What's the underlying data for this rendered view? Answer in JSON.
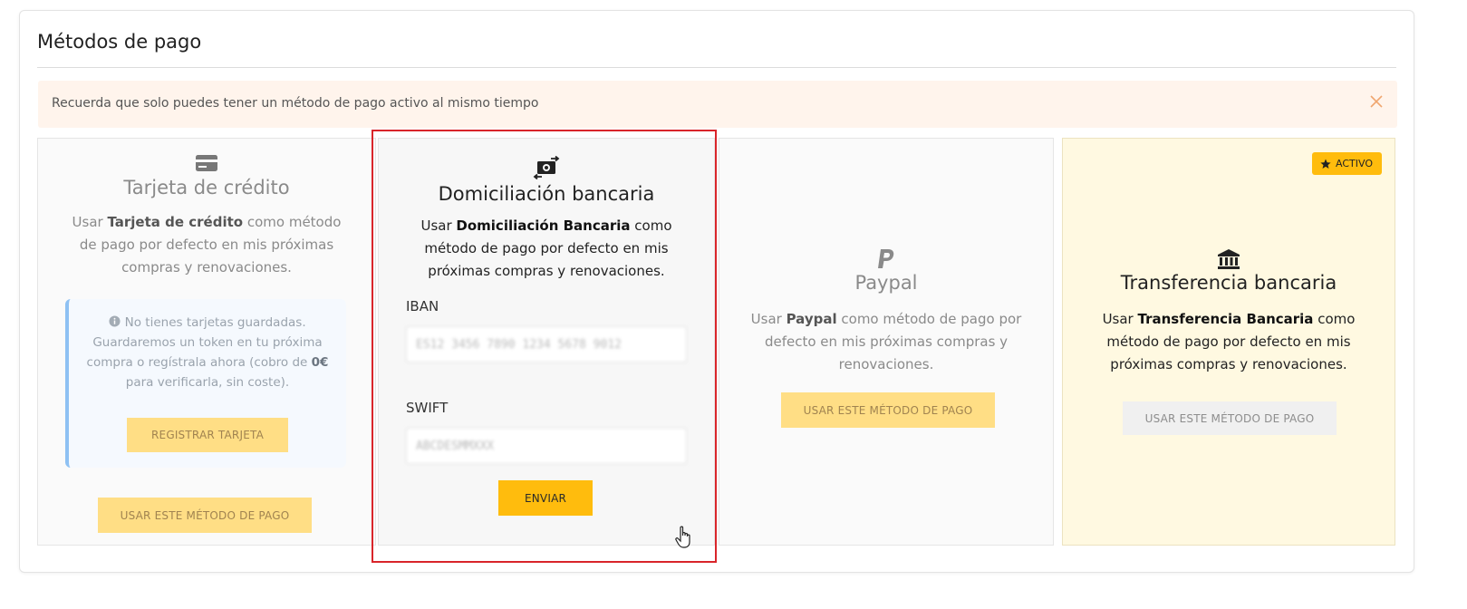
{
  "panel": {
    "title": "Métodos de pago"
  },
  "alert": {
    "text": "Recuerda que solo puedes tener un método de pago activo al mismo tiempo",
    "close_icon": "close-icon"
  },
  "cards": {
    "credit_card": {
      "icon": "credit-card-icon",
      "title": "Tarjeta de crédito",
      "desc_prefix": "Usar ",
      "desc_bold": "Tarjeta de crédito",
      "desc_suffix": " como método de pago por defecto en mis próximas compras y renovaciones.",
      "info_icon": "info-icon",
      "info_text_1": " No tienes tarjetas guardadas. Guardaremos un token en tu próxima compra o regístrala ahora (cobro de ",
      "info_bold": "0€",
      "info_text_2": " para verificarla, sin coste).",
      "register_button": "REGISTRAR TARJETA",
      "use_button": "USAR ESTE MÉTODO DE PAGO"
    },
    "direct_debit": {
      "icon": "money-transfer-icon",
      "title": "Domiciliación bancaria",
      "desc_prefix": "Usar ",
      "desc_bold": "Domiciliación Bancaria",
      "desc_suffix": " como método de pago por defecto en mis próximas compras y renovaciones.",
      "iban_label": "IBAN",
      "iban_value": "ES12 3456 7890 1234 5678 9012",
      "swift_label": "SWIFT",
      "swift_value": "ABCDESMMXXX",
      "submit_button": "ENVIAR"
    },
    "paypal": {
      "icon": "paypal-icon",
      "title": "Paypal",
      "desc_prefix": "Usar ",
      "desc_bold": "Paypal",
      "desc_suffix": " como método de pago por defecto en mis próximas compras y renovaciones.",
      "use_button": "USAR ESTE MÉTODO DE PAGO"
    },
    "bank_transfer": {
      "icon": "bank-icon",
      "badge": "ACTIVO",
      "badge_icon": "star-icon",
      "title": "Transferencia bancaria",
      "desc_prefix": "Usar ",
      "desc_bold": "Transferencia Bancaria",
      "desc_suffix": " como método de pago por defecto en mis próximas compras y renovaciones.",
      "use_button": "USAR ESTE MÉTODO DE PAGO"
    }
  },
  "colors": {
    "accent": "#ffbc0d",
    "accent_light": "#ffde85",
    "alert_bg": "#fff4ec",
    "active_card_bg": "#fff9e1",
    "highlight": "#d9252a"
  }
}
